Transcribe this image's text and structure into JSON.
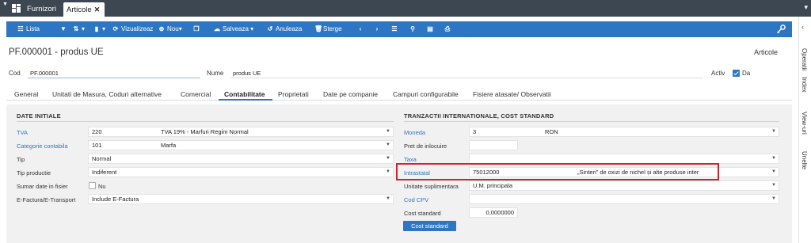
{
  "topbar": {
    "tabs": [
      {
        "label": "Furnizori"
      },
      {
        "label": "Articole",
        "close": "✕"
      }
    ]
  },
  "toolbar": {
    "lista": "Lista",
    "vizualizeaza": "Vizualizeaz",
    "nou": "Nou",
    "salveaza": "Salveaza",
    "anuleaza": "Anuleaza",
    "sterge": "Sterge"
  },
  "header": {
    "title": "PF.000001 - produs UE",
    "type": "Articole"
  },
  "form": {
    "cod_label": "Cod",
    "cod_value": "PF.000001",
    "nume_label": "Nume",
    "nume_value": "produs UE",
    "activ_label": "Activ",
    "activ_value": "Da"
  },
  "tabs": [
    {
      "label": "General"
    },
    {
      "label": "Unitati de Masura, Coduri alternative"
    },
    {
      "label": "Comercial"
    },
    {
      "label": "Contabilitate"
    },
    {
      "label": "Proprietati"
    },
    {
      "label": "Date pe companie"
    },
    {
      "label": "Campuri configurabile"
    },
    {
      "label": "Fisiere atasate/ Observatii"
    }
  ],
  "left_section": {
    "title": "DATE INITIALE",
    "tva": {
      "label": "TVA",
      "code": "220",
      "desc": "TVA 19% - Marfuri Regim Normal"
    },
    "categorie": {
      "label": "Categorie contabila",
      "code": "101",
      "desc": "Marfa"
    },
    "tip": {
      "label": "Tip",
      "value": "Normal"
    },
    "tip_productie": {
      "label": "Tip productie",
      "value": "Indiferent"
    },
    "sumar": {
      "label": "Sumar date in fisier",
      "value": "Nu"
    },
    "efactura": {
      "label": "E-Factura/E-Transport",
      "value": "Include E-Factura"
    }
  },
  "right_section": {
    "title": "TRANZACTII INTERNATIONALE, COST STANDARD",
    "moneda": {
      "label": "Moneda",
      "code": "3",
      "desc": "RON"
    },
    "pret": {
      "label": "Pret de inlocuire",
      "value": ""
    },
    "taxa": {
      "label": "Taxa",
      "value": ""
    },
    "intrastatal": {
      "label": "Intrastatal",
      "code": "75012000",
      "desc": "„Sinteri” de oxizi de nichel și alte produse inter"
    },
    "unitate": {
      "label": "Unitate suplimentara",
      "value": "U.M. principala"
    },
    "cod_cpv": {
      "label": "Cod CPV",
      "value": ""
    },
    "cost": {
      "label": "Cost standard",
      "value": "0,0000000"
    },
    "cost_button": "Cost standard"
  },
  "sidebar": {
    "items": [
      {
        "label": "Operatii"
      },
      {
        "label": "Index"
      },
      {
        "label": "View-uri"
      },
      {
        "label": "Unelte"
      }
    ]
  }
}
